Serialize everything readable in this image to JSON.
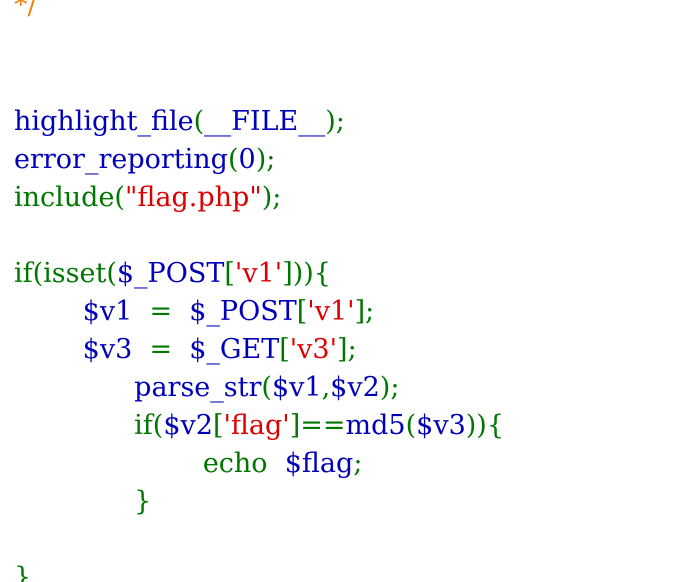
{
  "colors": {
    "default": "#0000bb",
    "keyword": "#007700",
    "string": "#dd0000",
    "comment": "#ff8000",
    "background": "#ffffff"
  },
  "code_lines": [
    {
      "tokens": [
        {
          "text": "*/",
          "type": "comment"
        }
      ]
    },
    {
      "tokens": []
    },
    {
      "tokens": []
    },
    {
      "tokens": [
        {
          "text": "highlight_file",
          "type": "default"
        },
        {
          "text": "(",
          "type": "keyword"
        },
        {
          "text": "__FILE__",
          "type": "default"
        },
        {
          "text": ");",
          "type": "keyword"
        }
      ]
    },
    {
      "tokens": [
        {
          "text": "error_reporting",
          "type": "default"
        },
        {
          "text": "(",
          "type": "keyword"
        },
        {
          "text": "0",
          "type": "default"
        },
        {
          "text": ");",
          "type": "keyword"
        }
      ]
    },
    {
      "tokens": [
        {
          "text": "include(",
          "type": "keyword"
        },
        {
          "text": "\"flag.php\"",
          "type": "string"
        },
        {
          "text": ");",
          "type": "keyword"
        }
      ]
    },
    {
      "tokens": []
    },
    {
      "tokens": [
        {
          "text": "if(isset(",
          "type": "keyword"
        },
        {
          "text": "$_POST",
          "type": "default"
        },
        {
          "text": "[",
          "type": "keyword"
        },
        {
          "text": "'v1'",
          "type": "string"
        },
        {
          "text": "])){",
          "type": "keyword"
        }
      ]
    },
    {
      "tokens": [
        {
          "text": "        $v1  ",
          "type": "default"
        },
        {
          "text": "=  ",
          "type": "keyword"
        },
        {
          "text": "$_POST",
          "type": "default"
        },
        {
          "text": "[",
          "type": "keyword"
        },
        {
          "text": "'v1'",
          "type": "string"
        },
        {
          "text": "];",
          "type": "keyword"
        }
      ]
    },
    {
      "tokens": [
        {
          "text": "        $v3  ",
          "type": "default"
        },
        {
          "text": "=  ",
          "type": "keyword"
        },
        {
          "text": "$_GET",
          "type": "default"
        },
        {
          "text": "[",
          "type": "keyword"
        },
        {
          "text": "'v3'",
          "type": "string"
        },
        {
          "text": "];",
          "type": "keyword"
        }
      ]
    },
    {
      "tokens": [
        {
          "text": "              parse_str",
          "type": "default"
        },
        {
          "text": "(",
          "type": "keyword"
        },
        {
          "text": "$v1",
          "type": "default"
        },
        {
          "text": ",",
          "type": "keyword"
        },
        {
          "text": "$v2",
          "type": "default"
        },
        {
          "text": ");",
          "type": "keyword"
        }
      ]
    },
    {
      "tokens": [
        {
          "text": "              if(",
          "type": "keyword"
        },
        {
          "text": "$v2",
          "type": "default"
        },
        {
          "text": "[",
          "type": "keyword"
        },
        {
          "text": "'flag'",
          "type": "string"
        },
        {
          "text": "]==",
          "type": "keyword"
        },
        {
          "text": "md5",
          "type": "default"
        },
        {
          "text": "(",
          "type": "keyword"
        },
        {
          "text": "$v3",
          "type": "default"
        },
        {
          "text": ")){",
          "type": "keyword"
        }
      ]
    },
    {
      "tokens": [
        {
          "text": "                      echo  ",
          "type": "keyword"
        },
        {
          "text": "$flag",
          "type": "default"
        },
        {
          "text": ";",
          "type": "keyword"
        }
      ]
    },
    {
      "tokens": [
        {
          "text": "              }",
          "type": "keyword"
        }
      ]
    },
    {
      "tokens": []
    },
    {
      "tokens": [
        {
          "text": "}",
          "type": "keyword"
        }
      ]
    }
  ]
}
